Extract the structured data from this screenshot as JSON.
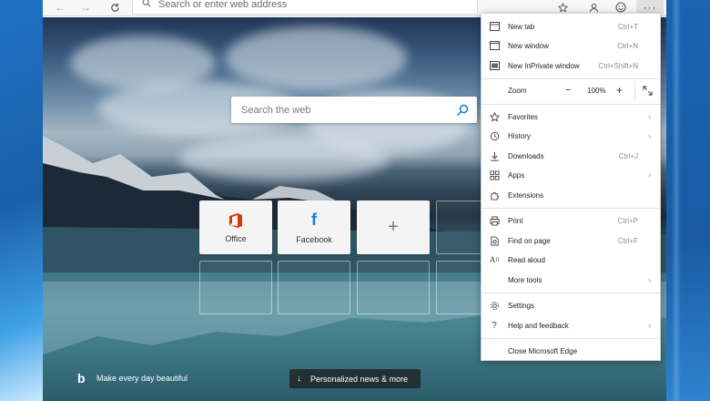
{
  "toolbar": {
    "address_placeholder": "Search or enter web address"
  },
  "search": {
    "placeholder": "Search the web"
  },
  "tiles": [
    {
      "label": "Office",
      "icon": "office-icon"
    },
    {
      "label": "Facebook",
      "icon": "facebook-icon"
    },
    {
      "label": "",
      "icon": "add-icon"
    }
  ],
  "footer": {
    "bing_tagline": "Make every day beautiful",
    "news_label": "Personalized news & more"
  },
  "menu": {
    "new_tab": {
      "label": "New tab",
      "shortcut": "Ctrl+T"
    },
    "new_window": {
      "label": "New window",
      "shortcut": "Ctrl+N"
    },
    "new_inprivate": {
      "label": "New InPrivate window",
      "shortcut": "Ctrl+Shift+N"
    },
    "zoom": {
      "label": "Zoom",
      "minus": "−",
      "value": "100%",
      "plus": "+"
    },
    "favorites": {
      "label": "Favorites"
    },
    "history": {
      "label": "History"
    },
    "downloads": {
      "label": "Downloads",
      "shortcut": "Ctrl+J"
    },
    "apps": {
      "label": "Apps"
    },
    "extensions": {
      "label": "Extensions"
    },
    "print": {
      "label": "Print",
      "shortcut": "Ctrl+P"
    },
    "find": {
      "label": "Find on page",
      "shortcut": "Ctrl+F"
    },
    "read_aloud": {
      "label": "Read aloud"
    },
    "more_tools": {
      "label": "More tools"
    },
    "settings": {
      "label": "Settings"
    },
    "help": {
      "label": "Help and feedback"
    },
    "close": {
      "label": "Close Microsoft Edge"
    }
  },
  "colors": {
    "office_orange": "#d83b01",
    "facebook_blue": "#1877f2",
    "search_icon_blue": "#0078d4"
  }
}
